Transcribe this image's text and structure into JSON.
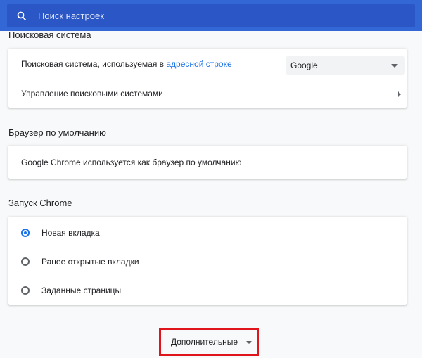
{
  "search": {
    "placeholder": "Поиск настроек",
    "icon": "search-icon"
  },
  "search_engine": {
    "title": "Поисковая система",
    "row1_prefix": "Поисковая система, используемая в ",
    "row1_link": "адресной строке",
    "selected_engine": "Google",
    "row2_label": "Управление поисковыми системами"
  },
  "default_browser": {
    "title": "Браузер по умолчанию",
    "status": "Google Chrome используется как браузер по умолчанию"
  },
  "startup": {
    "title": "Запуск Chrome",
    "options": [
      {
        "label": "Новая вкладка",
        "checked": true
      },
      {
        "label": "Ранее открытые вкладки",
        "checked": false
      },
      {
        "label": "Заданные страницы",
        "checked": false
      }
    ]
  },
  "advanced": {
    "label": "Дополнительные"
  },
  "colors": {
    "header": "#3367d6",
    "accent": "#1a73e8",
    "highlight": "#e0141b"
  }
}
